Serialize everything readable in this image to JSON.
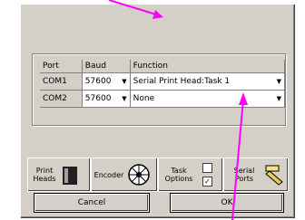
{
  "table": {
    "headers": [
      "Port",
      "Baud",
      "Function"
    ],
    "rows": [
      {
        "port": "COM1",
        "baud": "57600",
        "function": "Serial Print Head:Task 1"
      },
      {
        "port": "COM2",
        "baud": "57600",
        "function": "None"
      }
    ]
  },
  "tabs": {
    "print_heads": "Print Heads",
    "encoder": "Encoder",
    "task_options": "Task Options",
    "serial_ports": "Serial Ports"
  },
  "buttons": {
    "cancel": "Cancel",
    "ok": "OK"
  },
  "colors": {
    "dialog_bg": "#d4d0c8",
    "annotation_arrow": "#ff00ff"
  },
  "icons": [
    "print-head-icon",
    "encoder-wheel-icon",
    "checkbox-icon",
    "serial-plug-icon",
    "dropdown-arrow-icon"
  ]
}
